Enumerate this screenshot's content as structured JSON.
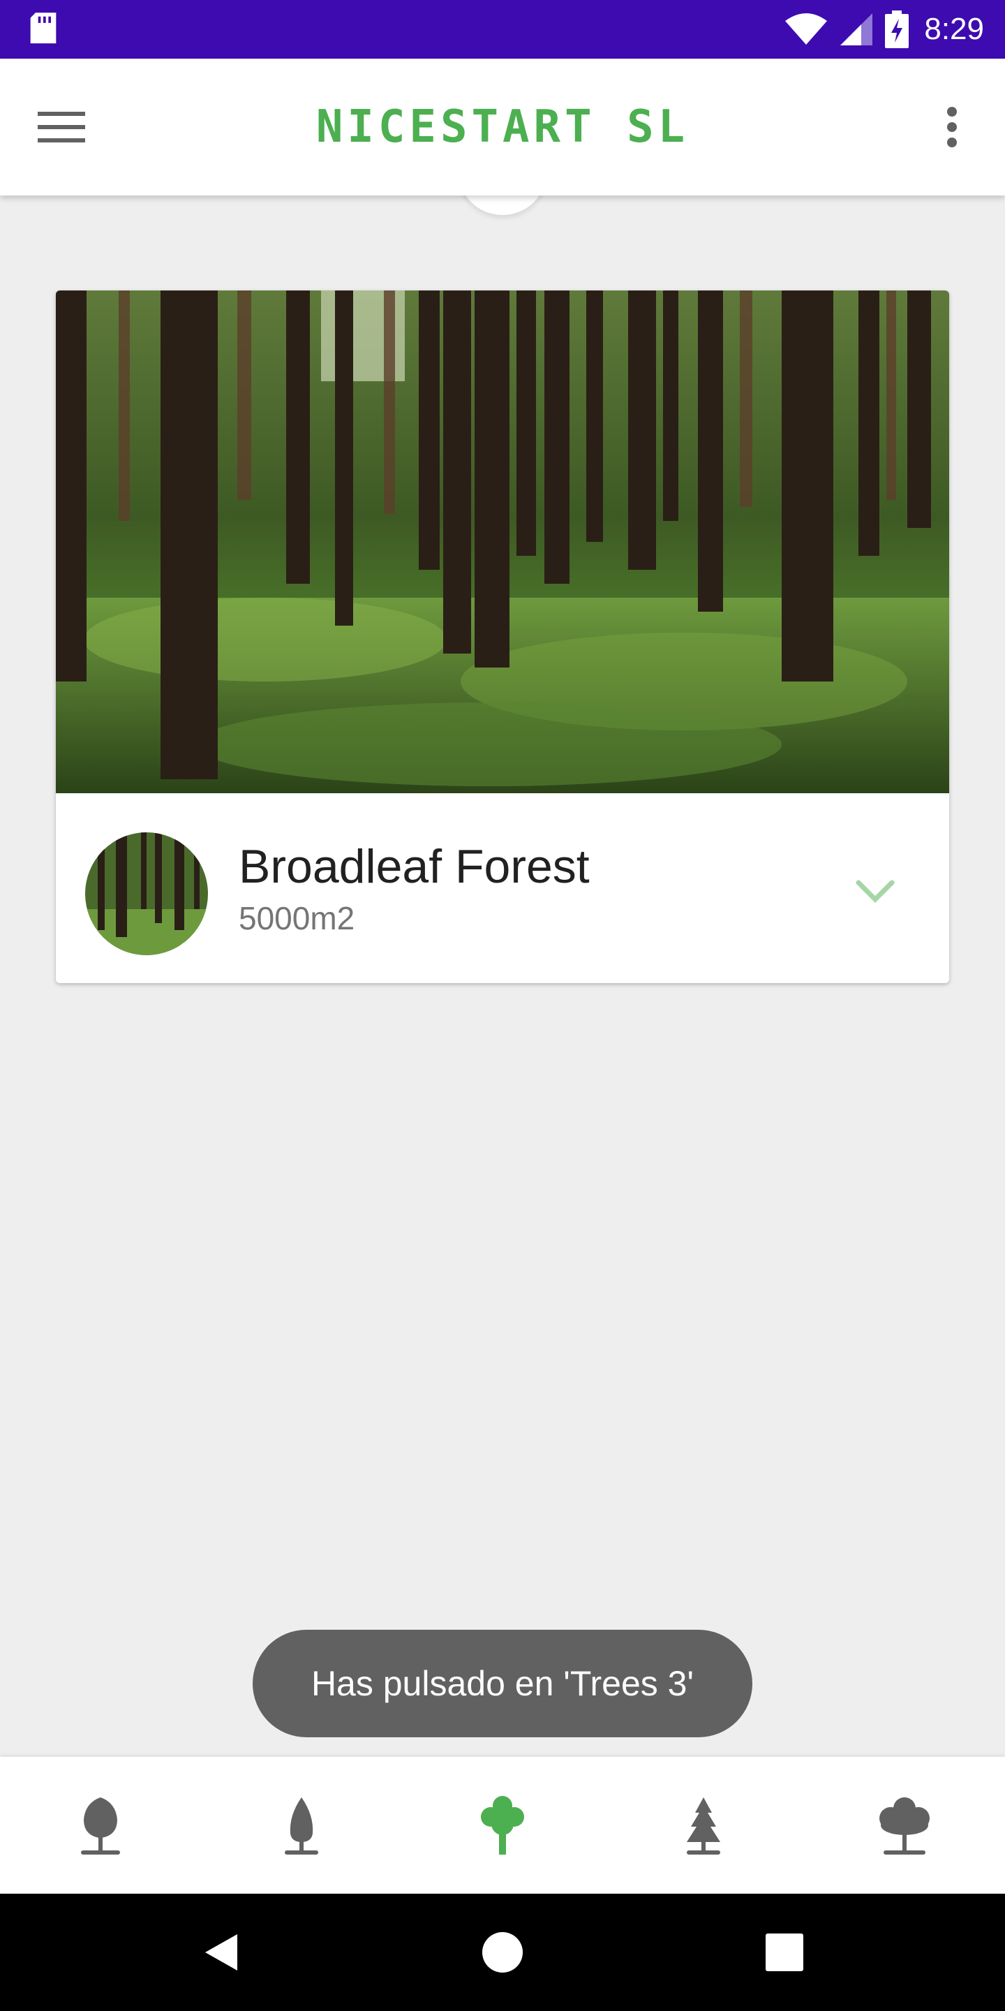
{
  "status_bar": {
    "time": "8:29",
    "icons": [
      "sd-card-icon",
      "wifi-icon",
      "cell-signal-icon",
      "battery-charging-icon"
    ],
    "background": "#3d0bb0"
  },
  "app_bar": {
    "title": "NICESTART SL",
    "title_color": "#4caf50",
    "left_icon": "menu-icon",
    "right_icon": "more-vert-icon"
  },
  "card": {
    "title": "Broadleaf Forest",
    "subtitle": "5000m2",
    "expand_icon": "chevron-down-icon",
    "accent": "#a5d6a7"
  },
  "toast": {
    "message": "Has pulsado en 'Trees 3'"
  },
  "bottom_nav": {
    "items": [
      {
        "icon": "tree-1-icon",
        "active": false
      },
      {
        "icon": "tree-2-icon",
        "active": false
      },
      {
        "icon": "tree-3-icon",
        "active": true
      },
      {
        "icon": "tree-4-icon",
        "active": false
      },
      {
        "icon": "tree-5-icon",
        "active": false
      }
    ],
    "active_color": "#4caf50",
    "inactive_color": "#616161"
  },
  "system_nav": {
    "buttons": [
      "back-icon",
      "home-icon",
      "recents-icon"
    ]
  }
}
